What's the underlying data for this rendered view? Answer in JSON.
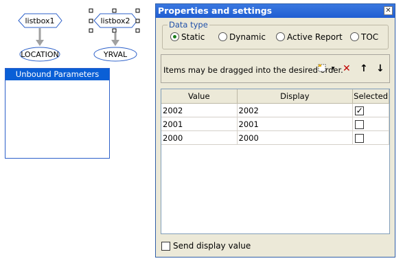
{
  "diagram": {
    "node1_label": "listbox1",
    "node2_label": "listbox2",
    "param1_label": "LOCATION",
    "param2_label": "YRVAL",
    "unbound_title": "Unbound Parameters"
  },
  "dialog": {
    "title": "Properties and settings",
    "close_symbol": "✕",
    "data_type_label": "Data type",
    "radios": [
      {
        "label": "Static",
        "checked": true
      },
      {
        "label": "Dynamic",
        "checked": false
      },
      {
        "label": "Active Report",
        "checked": false
      },
      {
        "label": "TOC",
        "checked": false
      }
    ],
    "hint": "Items may be dragged into the desired order.",
    "table": {
      "headers": [
        "Value",
        "Display",
        "Selected"
      ],
      "rows": [
        {
          "value": "2002",
          "display": "2002",
          "selected": true
        },
        {
          "value": "2001",
          "display": "2001",
          "selected": false
        },
        {
          "value": "2000",
          "display": "2000",
          "selected": false
        }
      ]
    },
    "send_display_label": "Send display value",
    "send_display_checked": false
  }
}
